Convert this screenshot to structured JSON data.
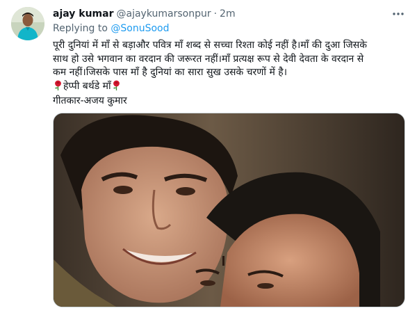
{
  "tweet": {
    "author_name": "ajay kumar",
    "author_handle": "@ajaykumarsonpur",
    "separator": "·",
    "timestamp": "2m",
    "replying_to_label": "Replying to",
    "replying_to_handle": "@SonuSood",
    "body_lines": [
      "पूरी दुनियां में माँ से बड़ाऔर पवित्र माँ शब्द से सच्चा रिश्ता कोई नहीं है।माँ की दुआ जिसके",
      "साथ हो उसे भगवान का वरदान की जरूरत नहीं।माँ प्रत्यक्ष रूप से देवी देवता के वरदान से",
      "कम नहीं।जिसके पास माँ है दुनियां का सारा सुख उसके चरणों में है।"
    ],
    "birthday_text": "हेप्पी बर्थडे माँ",
    "signature": "गीतकार-अजय कुमार"
  },
  "icons": {
    "more": "more-dots-icon",
    "rose": "rose-emoji-icon"
  },
  "colors": {
    "link": "#1d9bf0",
    "secondary_text": "#536471",
    "primary_text": "#0f1419",
    "media_border": "#cfd9de"
  }
}
